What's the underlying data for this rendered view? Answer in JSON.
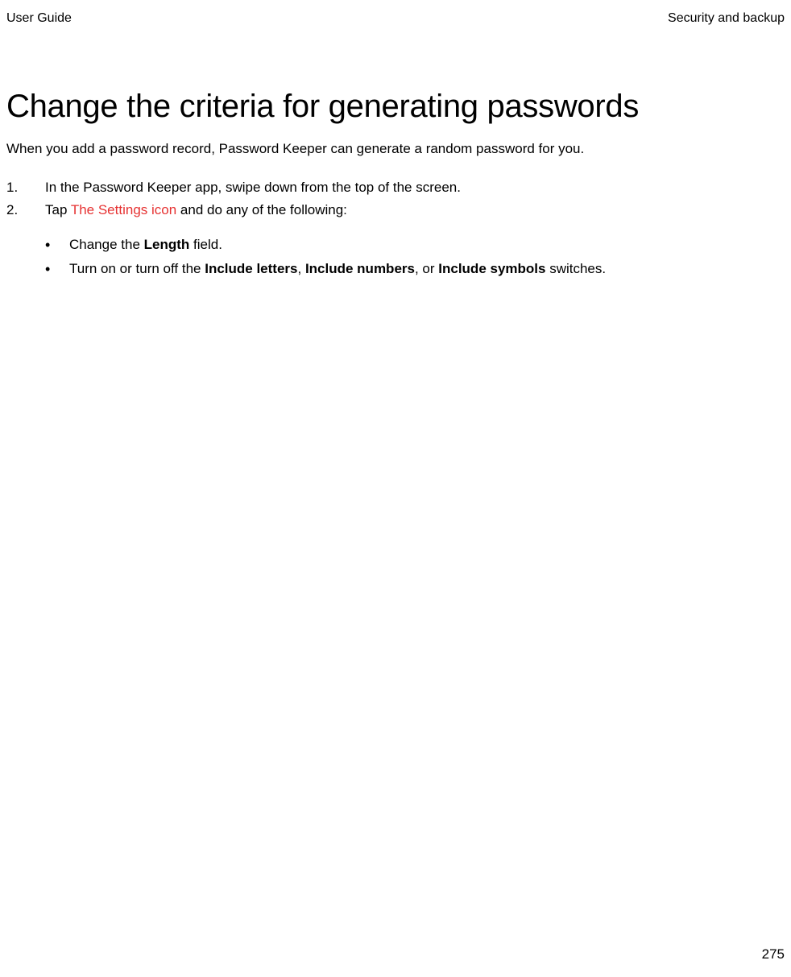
{
  "header": {
    "left": "User Guide",
    "right": "Security and backup"
  },
  "main": {
    "heading": "Change the criteria for generating passwords",
    "intro": "When you add a password record, Password Keeper can generate a random password for you.",
    "steps": [
      {
        "text": "In the Password Keeper app, swipe down from the top of the screen."
      },
      {
        "prefix": "Tap  ",
        "link": "The Settings icon",
        "suffix": "  and do any of the following:"
      }
    ],
    "bullets": [
      {
        "t1": "Change the ",
        "b1": "Length",
        "t2": " field."
      },
      {
        "t1": "Turn on or turn off the ",
        "b1": "Include letters",
        "t2": ", ",
        "b2": "Include numbers",
        "t3": ", or ",
        "b3": "Include symbols",
        "t4": " switches."
      }
    ]
  },
  "page_number": "275"
}
